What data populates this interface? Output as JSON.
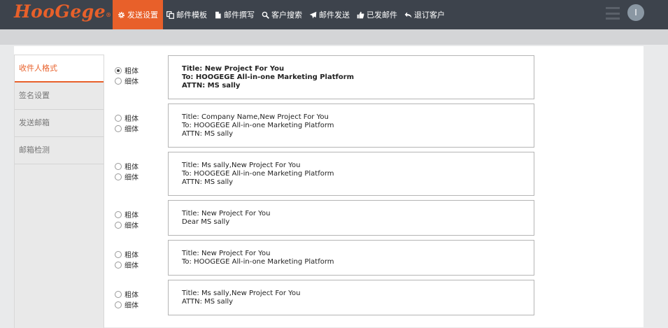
{
  "brand": {
    "logo_text": "HooGege",
    "logo_mark": "®"
  },
  "colors": {
    "accent": "#e8602a",
    "nav_bg": "#3d434c"
  },
  "nav": {
    "items": [
      {
        "label": "发送设置",
        "icon": "gear-icon",
        "active": true
      },
      {
        "label": "邮件模板",
        "icon": "copy-icon"
      },
      {
        "label": "邮件撰写",
        "icon": "document-icon"
      },
      {
        "label": "客户搜索",
        "icon": "search-icon"
      },
      {
        "label": "邮件发送",
        "icon": "paper-plane-icon"
      },
      {
        "label": "已发邮件",
        "icon": "thumbs-up-icon"
      },
      {
        "label": "退订客户",
        "icon": "reply-icon"
      }
    ],
    "avatar_initial": "I"
  },
  "sidebar": {
    "items": [
      {
        "label": "收件人格式",
        "active": true
      },
      {
        "label": "签名设置"
      },
      {
        "label": "发送邮箱"
      },
      {
        "label": "邮箱检测"
      }
    ]
  },
  "options": {
    "bold_label": "粗体",
    "thin_label": "细体",
    "rows": [
      {
        "selected": "bold",
        "lines": [
          "Title: New Project For You",
          "To: HOOGEGE All-in-one Marketing Platform",
          "ATTN: MS sally"
        ]
      },
      {
        "selected": "none",
        "lines": [
          "Title: Company Name,New Project For You",
          "To: HOOGEGE All-in-one Marketing Platform",
          "ATTN: MS sally"
        ]
      },
      {
        "selected": "none",
        "lines": [
          "Title: Ms sally,New Project For You",
          "To: HOOGEGE All-in-one Marketing Platform",
          "ATTN: MS sally"
        ]
      },
      {
        "selected": "none",
        "lines": [
          "Title: New Project For You",
          "Dear MS sally"
        ]
      },
      {
        "selected": "none",
        "lines": [
          "Title: New Project For You",
          "To: HOOGEGE All-in-one Marketing Platform"
        ]
      },
      {
        "selected": "none",
        "lines": [
          "Title: Ms sally,New Project For You",
          "ATTN: MS sally"
        ]
      }
    ]
  }
}
